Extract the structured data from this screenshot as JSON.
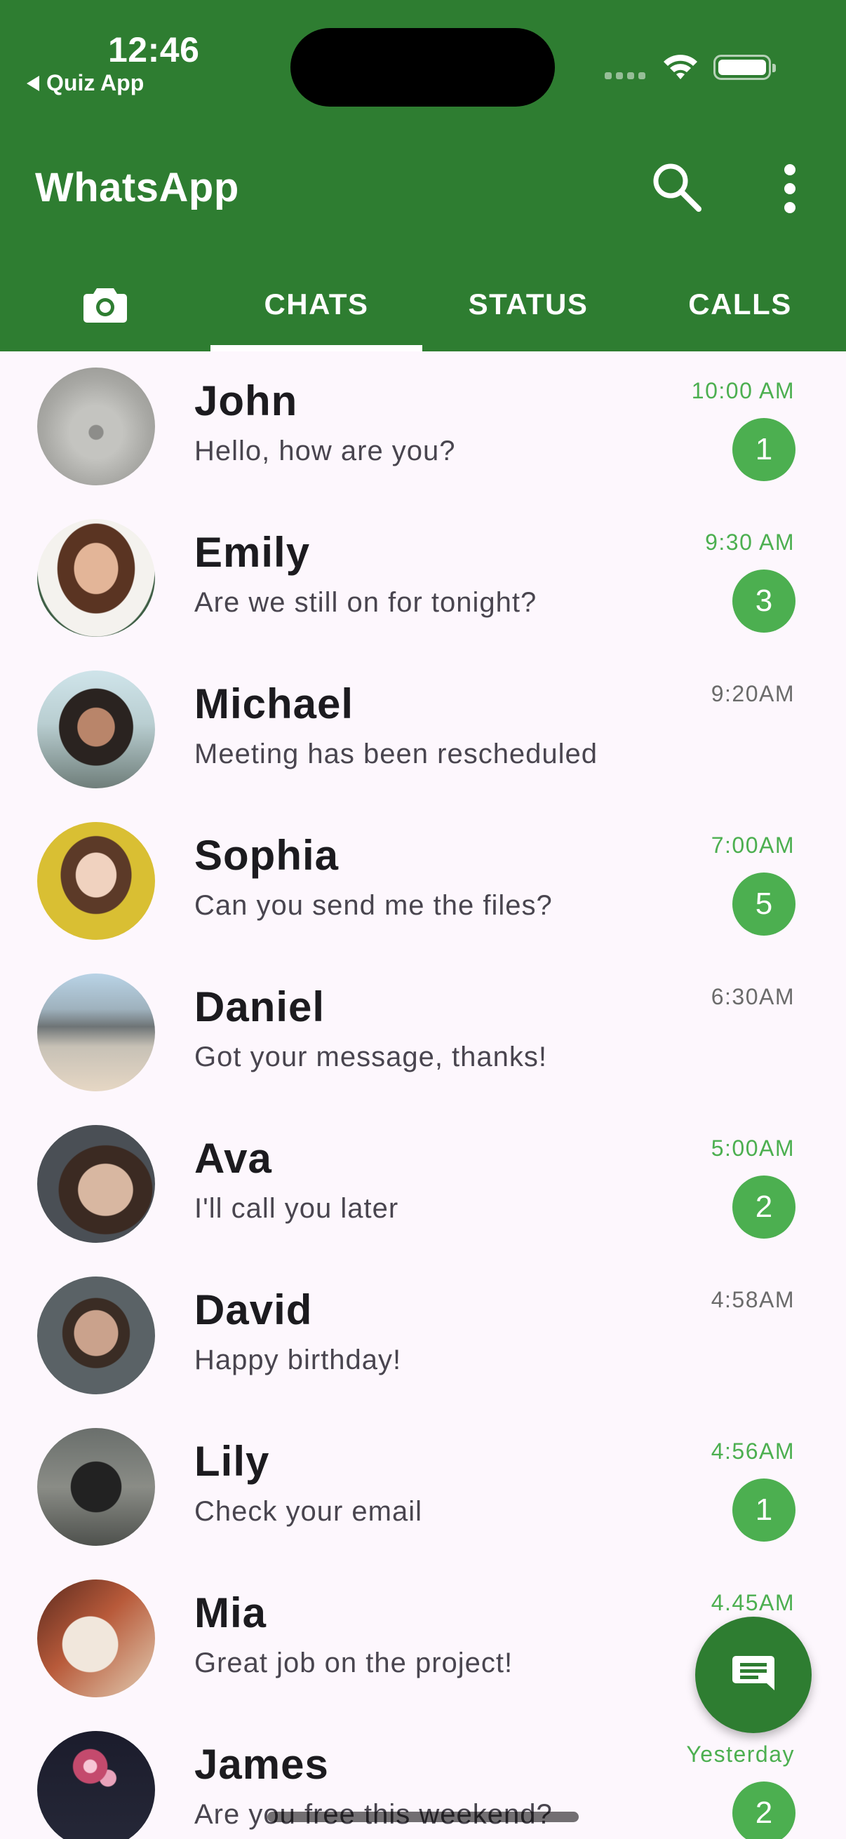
{
  "status_bar": {
    "time": "12:46",
    "back_app": "Quiz App"
  },
  "header": {
    "title": "WhatsApp",
    "search_icon": "search-icon",
    "more_icon": "more-vert-icon",
    "background_color": "#2e7d31"
  },
  "tabs": {
    "camera_icon": "camera-icon",
    "items": [
      {
        "label": "CHATS",
        "selected": true
      },
      {
        "label": "STATUS",
        "selected": false
      },
      {
        "label": "CALLS",
        "selected": false
      }
    ]
  },
  "chats": [
    {
      "name": "John",
      "message": "Hello, how are you?",
      "time": "10:00 AM",
      "unread": "1"
    },
    {
      "name": "Emily",
      "message": "Are we still on for tonight?",
      "time": "9:30 AM",
      "unread": "3"
    },
    {
      "name": "Michael",
      "message": "Meeting has been rescheduled",
      "time": "9:20AM",
      "unread": ""
    },
    {
      "name": "Sophia",
      "message": "Can you send me the files?",
      "time": "7:00AM",
      "unread": "5"
    },
    {
      "name": "Daniel",
      "message": "Got your message, thanks!",
      "time": "6:30AM",
      "unread": ""
    },
    {
      "name": "Ava",
      "message": "I'll call you later",
      "time": "5:00AM",
      "unread": "2"
    },
    {
      "name": "David",
      "message": "Happy birthday!",
      "time": "4:58AM",
      "unread": ""
    },
    {
      "name": "Lily",
      "message": "Check your email",
      "time": "4:56AM",
      "unread": "1"
    },
    {
      "name": "Mia",
      "message": "Great job on the project!",
      "time": "4.45AM",
      "unread": ""
    },
    {
      "name": "James",
      "message": "Are you free this weekend?",
      "time": "Yesterday",
      "unread": "2"
    }
  ],
  "fab": {
    "icon": "message-icon"
  },
  "colors": {
    "accent_green": "#4caf50",
    "primary_green": "#2e7d31",
    "background": "#fdf7fd"
  }
}
